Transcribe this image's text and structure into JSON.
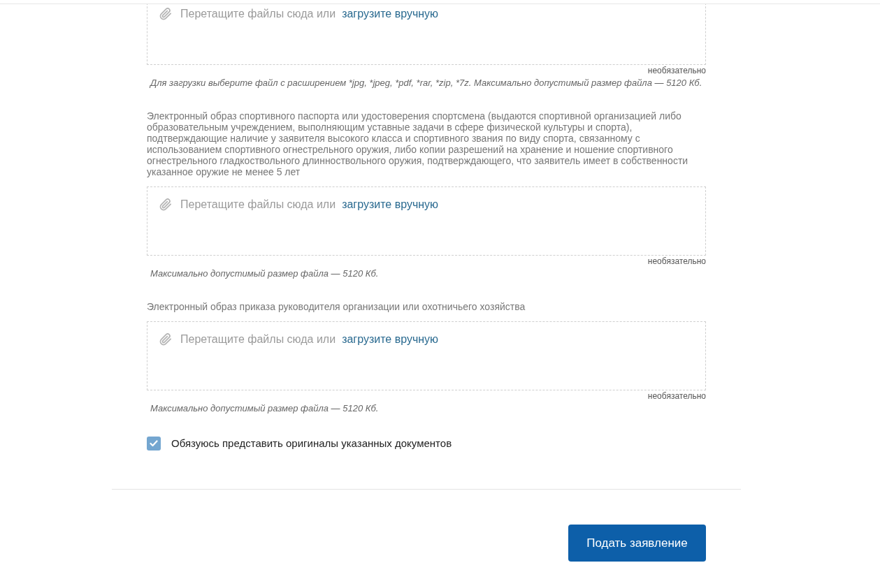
{
  "upload_sections": [
    {
      "dropzone": {
        "prompt": "Перетащите файлы сюда или",
        "link": "загрузите вручную"
      },
      "optional_note": "необязательно",
      "hint": "Для загрузки выберите файл с расширением *jpg, *jpeg, *pdf, *rar, *zip, *7z. Максимально допустимый размер файла — 5120 Кб."
    },
    {
      "label": "Электронный образ спортивного паспорта или удостоверения спортсмена (выдаются спортивной организацией либо образовательным учреждением, выполняющим уставные задачи в сфере физической культуры и спорта), подтверждающие наличие у заявителя высокого класса и спортивного звания по виду спорта, связанному с использованием спортивного огнестрельного оружия, либо копии разрешений на хранение и ношение спортивного огнестрельного гладкоствольного длинноствольного оружия, подтверждающего, что заявитель имеет в собственности указанное оружие не менее 5 лет",
      "dropzone": {
        "prompt": "Перетащите файлы сюда или",
        "link": "загрузите вручную"
      },
      "optional_note": "необязательно",
      "hint": "Максимально допустимый размер файла — 5120 Кб."
    },
    {
      "label": "Электронный образ приказа руководителя организации или охотничьего хозяйства",
      "dropzone": {
        "prompt": "Перетащите файлы сюда или",
        "link": "загрузите вручную"
      },
      "optional_note": "необязательно",
      "hint": "Максимально допустимый размер файла — 5120 Кб."
    }
  ],
  "agreement": {
    "label": "Обязуюсь представить оригиналы указанных документов",
    "checked": true
  },
  "submit_button": "Подать заявление"
}
